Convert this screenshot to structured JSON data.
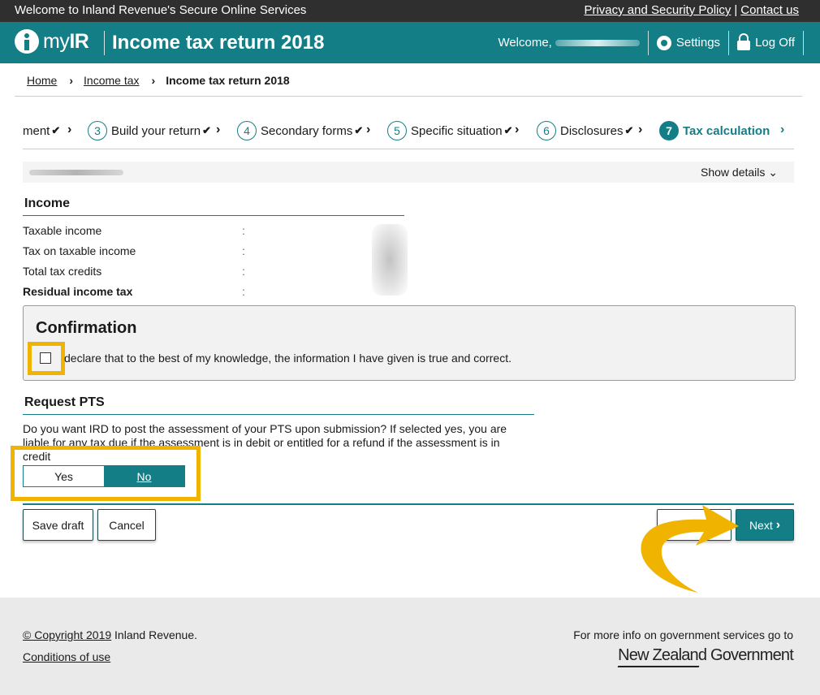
{
  "topbar": {
    "welcome": "Welcome to Inland Revenue's Secure Online Services",
    "privacy": "Privacy and Security Policy",
    "separator": "|",
    "contact": "Contact us"
  },
  "header": {
    "brand_my": "my",
    "brand_ir": "IR",
    "title": "Income tax return 2018",
    "welcome_label": "Welcome,",
    "settings": "Settings",
    "logoff": "Log Off"
  },
  "breadcrumb": {
    "home": "Home",
    "income_tax": "Income tax",
    "current": "Income tax return 2018",
    "chevron": "›"
  },
  "steps": [
    {
      "num": "",
      "label": "ment",
      "done": true
    },
    {
      "num": "3",
      "label": "Build your return",
      "done": true
    },
    {
      "num": "4",
      "label": "Secondary forms",
      "done": true
    },
    {
      "num": "5",
      "label": "Specific situation",
      "done": true
    },
    {
      "num": "6",
      "label": "Disclosures",
      "done": true
    },
    {
      "num": "7",
      "label": "Tax calculation",
      "done": false,
      "active": true
    }
  ],
  "step_tick": "✔",
  "step_arrow": "›",
  "details": {
    "show_details": "Show details ⌄"
  },
  "income": {
    "heading": "Income",
    "colon": ":",
    "rows": [
      {
        "label": "Taxable income"
      },
      {
        "label": "Tax on taxable income"
      },
      {
        "label": "Total tax credits"
      },
      {
        "label": "Residual income tax"
      }
    ]
  },
  "confirmation": {
    "heading": "Confirmation",
    "declaration": "declare that to the best of my knowledge, the information I have given is true and correct.",
    "checked": false
  },
  "pts": {
    "heading": "Request PTS",
    "question": "Do you want IRD to post the assessment of your PTS upon submission? If selected yes, you are liable for any tax due if the assessment is in debit or entitled for a refund if the assessment is in credit",
    "yes": "Yes",
    "no": "No",
    "selected": "No"
  },
  "actions": {
    "save_draft": "Save draft",
    "cancel": "Cancel",
    "next": "Next",
    "next_chevron": "›"
  },
  "footer": {
    "copyright_link": "© Copyright 2019",
    "copyright_rest": " Inland Revenue.",
    "conditions": "Conditions of use",
    "info": "For more info on government services go to",
    "nzgov": "New Zealand Government"
  },
  "colors": {
    "teal": "#147e86",
    "highlight": "#f0b400",
    "topbar": "#2f2f2f",
    "footer_bg": "#eaeaea"
  }
}
